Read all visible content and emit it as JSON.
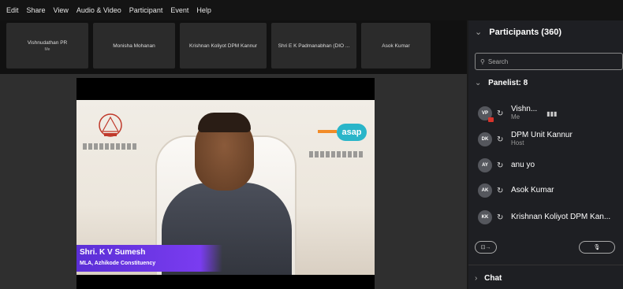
{
  "menu": [
    "Edit",
    "Share",
    "View",
    "Audio & Video",
    "Participant",
    "Event",
    "Help"
  ],
  "tiles": [
    {
      "name": "Vishnudathan PR",
      "sub": "Me"
    },
    {
      "name": "Monisha Mohanan",
      "sub": ""
    },
    {
      "name": "Krishnan Koliyot DPM Kannur",
      "sub": ""
    },
    {
      "name": "Shri E K Padmanabhan (DIO ...",
      "sub": ""
    },
    {
      "name": "Asok Kumar",
      "sub": ""
    }
  ],
  "video": {
    "name": "Shri. K V Sumesh",
    "role": "MLA, Azhikode Constituency",
    "logo_text": "asap"
  },
  "panel": {
    "title": "Participants (360)",
    "search_placeholder": "Search",
    "section": "Panelist: 8",
    "participants": [
      {
        "initials": "VP",
        "name": "Vishn...",
        "sub": "Me",
        "recording": true
      },
      {
        "initials": "DK",
        "name": "DPM Unit Kannur",
        "sub": "Host",
        "recording": false
      },
      {
        "initials": "AY",
        "name": "anu yo",
        "sub": "",
        "recording": false
      },
      {
        "initials": "AK",
        "name": "Asok Kumar",
        "sub": "",
        "recording": false
      },
      {
        "initials": "KK",
        "name": "Krishnan Koliyot DPM Kan...",
        "sub": "",
        "recording": false
      }
    ],
    "chat_label": "Chat"
  },
  "colors": {
    "accent": "#7a3cf0",
    "asap": "#2ab5c9",
    "record": "#d9342b"
  }
}
